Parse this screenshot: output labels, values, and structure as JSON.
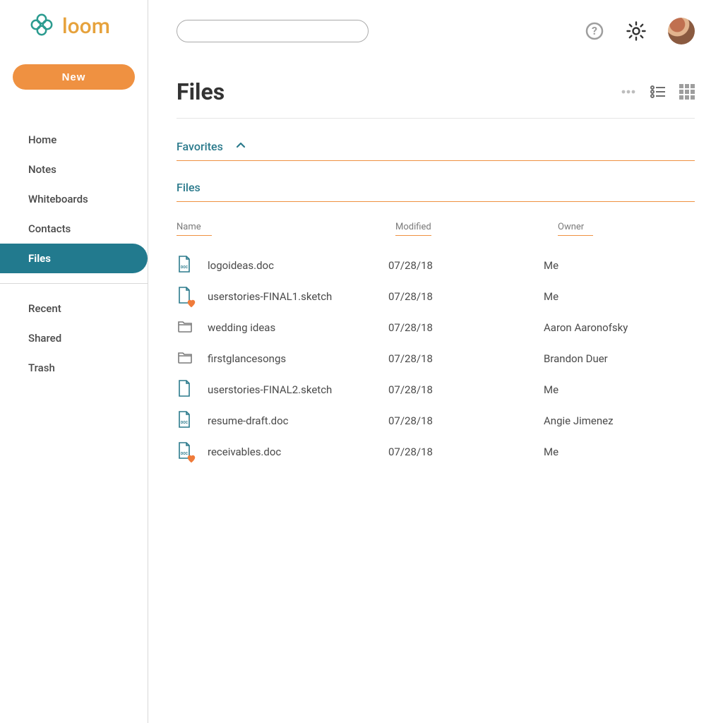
{
  "brand": {
    "name": "loom"
  },
  "sidebar": {
    "new_label": "New",
    "primary": [
      {
        "label": "Home"
      },
      {
        "label": "Notes"
      },
      {
        "label": "Whiteboards"
      },
      {
        "label": "Contacts"
      },
      {
        "label": "Files",
        "active": true
      }
    ],
    "secondary": [
      {
        "label": "Recent"
      },
      {
        "label": "Shared"
      },
      {
        "label": "Trash"
      }
    ]
  },
  "page": {
    "title": "Files"
  },
  "sections": {
    "favorites_label": "Favorites",
    "files_label": "Files"
  },
  "columns": {
    "name": "Name",
    "modified": "Modified",
    "owner": "Owner"
  },
  "files": [
    {
      "icon": "doc",
      "favorite": false,
      "name": "logoideas.doc",
      "modified": "07/28/18",
      "owner": "Me"
    },
    {
      "icon": "file",
      "favorite": true,
      "name": "userstories-FINAL1.sketch",
      "modified": "07/28/18",
      "owner": "Me"
    },
    {
      "icon": "folder",
      "favorite": false,
      "name": "wedding ideas",
      "modified": "07/28/18",
      "owner": "Aaron Aaronofsky"
    },
    {
      "icon": "folder",
      "favorite": false,
      "name": "firstglancesongs",
      "modified": "07/28/18",
      "owner": "Brandon Duer"
    },
    {
      "icon": "file",
      "favorite": false,
      "name": "userstories-FINAL2.sketch",
      "modified": "07/28/18",
      "owner": "Me"
    },
    {
      "icon": "doc",
      "favorite": false,
      "name": "resume-draft.doc",
      "modified": "07/28/18",
      "owner": "Angie Jimenez"
    },
    {
      "icon": "doc",
      "favorite": true,
      "name": "receivables.doc",
      "modified": "07/28/18",
      "owner": "Me"
    }
  ],
  "colors": {
    "accent_teal": "#2B7A8C",
    "accent_orange": "#EF9141",
    "brand_yellow": "#E6A23C"
  }
}
